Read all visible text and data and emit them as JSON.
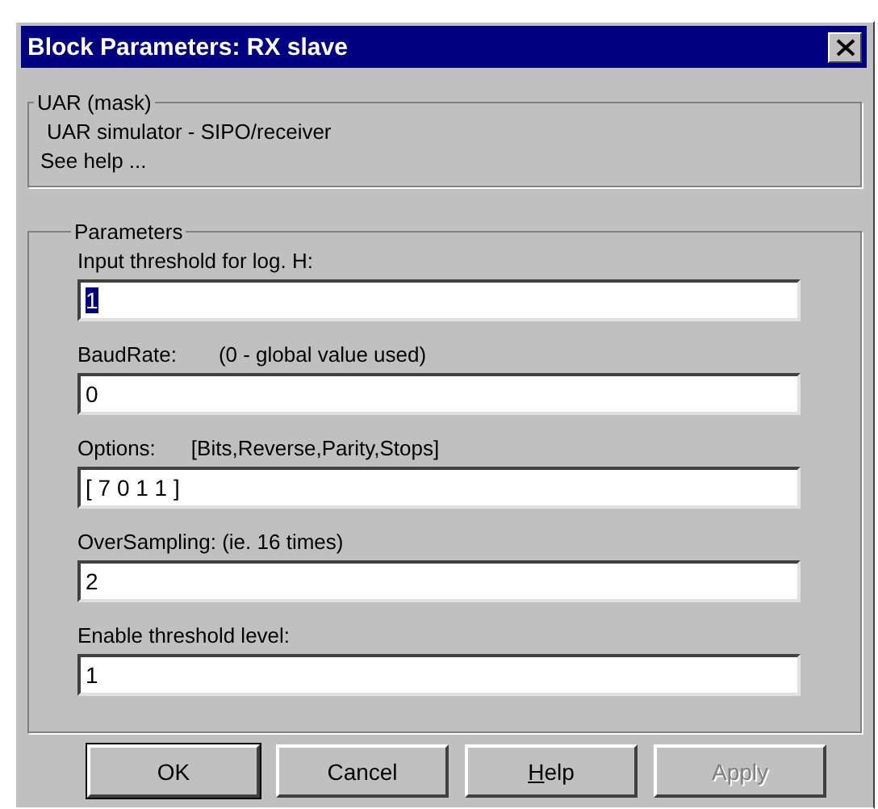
{
  "window": {
    "title": "Block Parameters: RX slave"
  },
  "mask_group": {
    "title": "UAR (mask)",
    "description": "UAR simulator - SIPO/receiver",
    "help_note": "See help ..."
  },
  "parameters_group": {
    "title": "Parameters",
    "fields": [
      {
        "label": "Input threshold for log. H:",
        "value": "1",
        "text_selected": true
      },
      {
        "label": "BaudRate:",
        "hint": "(0 - global value used)",
        "value": "0",
        "text_selected": false
      },
      {
        "label": "Options:",
        "hint": "[Bits,Reverse,Parity,Stops]",
        "value": "[ 7  0  1  1 ]",
        "text_selected": false
      },
      {
        "label": "OverSampling: (ie. 16 times)",
        "value": "2",
        "text_selected": false
      },
      {
        "label": "Enable threshold level:",
        "value": "1",
        "text_selected": false
      }
    ]
  },
  "buttons": [
    {
      "label": "OK",
      "default": true,
      "disabled": false,
      "mnemonic": false
    },
    {
      "label": "Cancel",
      "default": false,
      "disabled": false,
      "mnemonic": false
    },
    {
      "label": "Help",
      "default": false,
      "disabled": false,
      "mnemonic": true
    },
    {
      "label": "Apply",
      "default": false,
      "disabled": true,
      "mnemonic": false
    }
  ]
}
